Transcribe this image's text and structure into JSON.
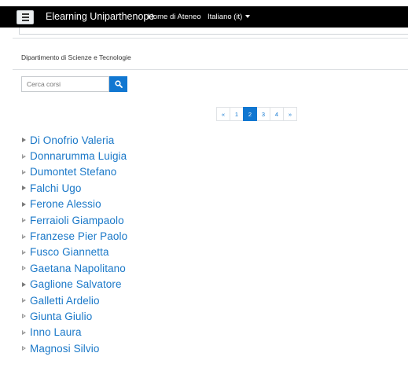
{
  "navbar": {
    "brand": "Elearning Uniparthenope",
    "home_label": "Home di Ateneo",
    "language_label": "Italiano (it)"
  },
  "department": "Dipartimento di Scienze e Tecnologie",
  "search": {
    "placeholder": "Cerca corsi",
    "value": ""
  },
  "pagination": {
    "prev": "«",
    "pages": [
      "1",
      "2",
      "3",
      "4"
    ],
    "current": "2",
    "next": "»"
  },
  "categories": [
    {
      "name": "Di Onofrio Valeria",
      "expandable": true
    },
    {
      "name": "Donnarumma Luigia",
      "expandable": false
    },
    {
      "name": "Dumontet Stefano",
      "expandable": false
    },
    {
      "name": "Falchi Ugo",
      "expandable": true
    },
    {
      "name": "Ferone Alessio",
      "expandable": true
    },
    {
      "name": "Ferraioli Giampaolo",
      "expandable": false
    },
    {
      "name": "Franzese Pier Paolo",
      "expandable": false
    },
    {
      "name": "Fusco Giannetta",
      "expandable": false
    },
    {
      "name": "Gaetana Napolitano",
      "expandable": false
    },
    {
      "name": "Gaglione Salvatore",
      "expandable": true
    },
    {
      "name": "Galletti Ardelio",
      "expandable": false
    },
    {
      "name": "Giunta Giulio",
      "expandable": false
    },
    {
      "name": "Inno Laura",
      "expandable": false
    },
    {
      "name": "Magnosi Silvio",
      "expandable": false
    }
  ],
  "colors": {
    "navbar_bg": "#000000",
    "link": "#1a78c8",
    "accent": "#1177d1"
  },
  "icons": {
    "menu": "hamburger-icon",
    "search": "search-icon",
    "language_dropdown": "caret-down-icon",
    "category_toggle": "triangle-right-icon"
  }
}
